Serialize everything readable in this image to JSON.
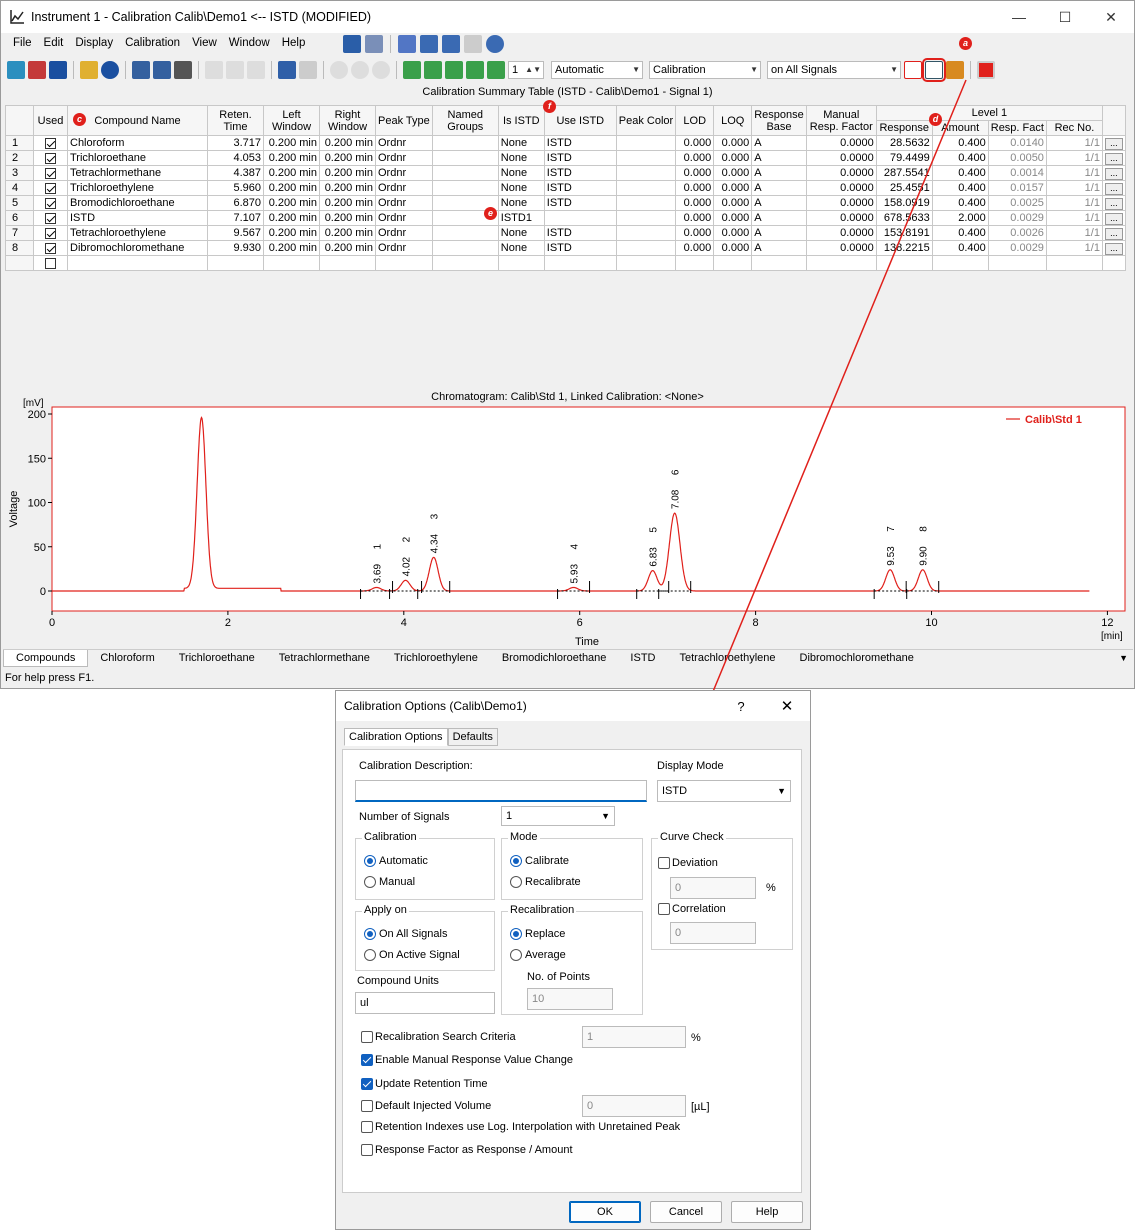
{
  "window": {
    "title": "Instrument 1 - Calibration Calib\\Demo1 <-- ISTD (MODIFIED)",
    "minimize": "—",
    "maximize": "☐",
    "close": "✕"
  },
  "menu": [
    "File",
    "Edit",
    "Display",
    "Calibration",
    "View",
    "Window",
    "Help"
  ],
  "toolbar": {
    "spin_value": "1",
    "combo_mode": "Automatic",
    "combo_calibration": "Calibration",
    "combo_signals": "on All Signals"
  },
  "callouts": {
    "a": "a",
    "c": "c",
    "d": "d",
    "e": "e",
    "f": "f"
  },
  "table": {
    "title": "Calibration Summary Table (ISTD - Calib\\Demo1 - Signal 1)",
    "headers": {
      "used": "Used",
      "compound": "Compound Name",
      "reten": "Reten. Time",
      "left": "Left Window",
      "right": "Right Window",
      "peaktype": "Peak Type",
      "named": "Named Groups",
      "isistd": "Is ISTD",
      "useistd": "Use ISTD",
      "peakcolor": "Peak Color",
      "lod": "LOD",
      "loq": "LOQ",
      "respbase": "Response Base",
      "manual": "Manual Resp. Factor",
      "level": "Level 1",
      "response": "Response",
      "amount": "Amount",
      "respfact": "Resp. Fact",
      "recno": "Rec No."
    },
    "rows": [
      {
        "n": "1",
        "used": true,
        "name": "Chloroform",
        "rt": "3.717",
        "lw": "0.200 min",
        "rw": "0.200 min",
        "pt": "Ordnr",
        "ng": "",
        "is": "None",
        "use": "ISTD",
        "lod": "0.000",
        "loq": "0.000",
        "rb": "A",
        "mrf": "0.0000",
        "resp": "28.5632",
        "amt": "0.400",
        "rf": "0.0140",
        "rec": "1/1"
      },
      {
        "n": "2",
        "used": true,
        "name": "Trichloroethane",
        "rt": "4.053",
        "lw": "0.200 min",
        "rw": "0.200 min",
        "pt": "Ordnr",
        "ng": "",
        "is": "None",
        "use": "ISTD",
        "lod": "0.000",
        "loq": "0.000",
        "rb": "A",
        "mrf": "0.0000",
        "resp": "79.4499",
        "amt": "0.400",
        "rf": "0.0050",
        "rec": "1/1"
      },
      {
        "n": "3",
        "used": true,
        "name": "Tetrachlormethane",
        "rt": "4.387",
        "lw": "0.200 min",
        "rw": "0.200 min",
        "pt": "Ordnr",
        "ng": "",
        "is": "None",
        "use": "ISTD",
        "lod": "0.000",
        "loq": "0.000",
        "rb": "A",
        "mrf": "0.0000",
        "resp": "287.5541",
        "amt": "0.400",
        "rf": "0.0014",
        "rec": "1/1"
      },
      {
        "n": "4",
        "used": true,
        "name": "Trichloroethylene",
        "rt": "5.960",
        "lw": "0.200 min",
        "rw": "0.200 min",
        "pt": "Ordnr",
        "ng": "",
        "is": "None",
        "use": "ISTD",
        "lod": "0.000",
        "loq": "0.000",
        "rb": "A",
        "mrf": "0.0000",
        "resp": "25.4551",
        "amt": "0.400",
        "rf": "0.0157",
        "rec": "1/1"
      },
      {
        "n": "5",
        "used": true,
        "name": "Bromodichloroethane",
        "rt": "6.870",
        "lw": "0.200 min",
        "rw": "0.200 min",
        "pt": "Ordnr",
        "ng": "",
        "is": "None",
        "use": "ISTD",
        "lod": "0.000",
        "loq": "0.000",
        "rb": "A",
        "mrf": "0.0000",
        "resp": "158.0919",
        "amt": "0.400",
        "rf": "0.0025",
        "rec": "1/1"
      },
      {
        "n": "6",
        "used": true,
        "name": "ISTD",
        "rt": "7.107",
        "lw": "0.200 min",
        "rw": "0.200 min",
        "pt": "Ordnr",
        "ng": "",
        "is": "ISTD1",
        "use": "",
        "lod": "0.000",
        "loq": "0.000",
        "rb": "A",
        "mrf": "0.0000",
        "resp": "678.5633",
        "amt": "2.000",
        "rf": "0.0029",
        "rec": "1/1"
      },
      {
        "n": "7",
        "used": true,
        "name": "Tetrachloroethylene",
        "rt": "9.567",
        "lw": "0.200 min",
        "rw": "0.200 min",
        "pt": "Ordnr",
        "ng": "",
        "is": "None",
        "use": "ISTD",
        "lod": "0.000",
        "loq": "0.000",
        "rb": "A",
        "mrf": "0.0000",
        "resp": "153.8191",
        "amt": "0.400",
        "rf": "0.0026",
        "rec": "1/1"
      },
      {
        "n": "8",
        "used": true,
        "name": "Dibromochloromethane",
        "rt": "9.930",
        "lw": "0.200 min",
        "rw": "0.200 min",
        "pt": "Ordnr",
        "ng": "",
        "is": "None",
        "use": "ISTD",
        "lod": "0.000",
        "loq": "0.000",
        "rb": "A",
        "mrf": "0.0000",
        "resp": "138.2215",
        "amt": "0.400",
        "rf": "0.0029",
        "rec": "1/1"
      }
    ],
    "more_button": "..."
  },
  "chart_data": {
    "type": "line",
    "title": "Chromatogram: Calib\\Std 1, Linked Calibration: <None>",
    "xlabel": "Time",
    "ylabel": "Voltage",
    "xunit": "[min]",
    "yunit": "[mV]",
    "xlim": [
      0,
      12
    ],
    "ylim": [
      -5,
      210
    ],
    "xticks": [
      0,
      2,
      4,
      6,
      8,
      10,
      12
    ],
    "yticks": [
      0,
      50,
      100,
      150,
      200
    ],
    "legend": "Calib\\Std 1",
    "legend_position": "top-right",
    "color": "#e0201b",
    "peaks": [
      {
        "rt": 1.7,
        "height": 193,
        "width": 0.05,
        "label": "",
        "num": ""
      },
      {
        "rt": 3.69,
        "height": 4,
        "width": 0.05,
        "label": "3.69",
        "num": "1"
      },
      {
        "rt": 4.02,
        "height": 12,
        "width": 0.05,
        "label": "4.02",
        "num": "2"
      },
      {
        "rt": 4.34,
        "height": 38,
        "width": 0.05,
        "label": "4.34",
        "num": "3"
      },
      {
        "rt": 5.93,
        "height": 4,
        "width": 0.05,
        "label": "5.93",
        "num": "4"
      },
      {
        "rt": 6.83,
        "height": 23,
        "width": 0.05,
        "label": "6.83",
        "num": "5"
      },
      {
        "rt": 7.08,
        "height": 88,
        "width": 0.06,
        "label": "7.08",
        "num": "6"
      },
      {
        "rt": 9.53,
        "height": 24,
        "width": 0.05,
        "label": "9.53",
        "num": "7"
      },
      {
        "rt": 9.9,
        "height": 24,
        "width": 0.05,
        "label": "9.90",
        "num": "8"
      }
    ]
  },
  "bottom_tabs": [
    "Compounds",
    "Chloroform",
    "Trichloroethane",
    "Tetrachlormethane",
    "Trichloroethylene",
    "Bromodichloroethane",
    "ISTD",
    "Tetrachloroethylene",
    "Dibromochloromethane"
  ],
  "status": "For help press F1.",
  "dialog": {
    "title": "Calibration Options (Calib\\Demo1)",
    "help": "?",
    "close": "✕",
    "tabs": [
      "Calibration Options",
      "Defaults"
    ],
    "calib_desc_label": "Calibration Description:",
    "calib_desc_value": "",
    "display_mode_label": "Display Mode",
    "display_mode_value": "ISTD",
    "num_signals_label": "Number of Signals",
    "num_signals_value": "1",
    "calibration_group": "Calibration",
    "automatic": "Automatic",
    "manual": "Manual",
    "mode_group": "Mode",
    "calibrate": "Calibrate",
    "recalibrate": "Recalibrate",
    "curve_group": "Curve Check",
    "deviation": "Deviation",
    "deviation_value": "0",
    "pct": "%",
    "correlation": "Correlation",
    "correlation_value": "0",
    "apply_group": "Apply on",
    "all_signals": "On All Signals",
    "active_signal": "On Active Signal",
    "recal_group": "Recalibration",
    "replace": "Replace",
    "average": "Average",
    "points_label": "No. of Points",
    "points_value": "10",
    "units_label": "Compound Units",
    "units_value": "ul",
    "recal_search": "Recalibration Search Criteria",
    "recal_search_value": "1",
    "manual_resp": "Enable Manual Response Value Change",
    "update_rt": "Update Retention Time",
    "default_inj": "Default Injected Volume",
    "default_inj_value": "0",
    "ul_unit": "[µL]",
    "retention_idx": "Retention Indexes use Log. Interpolation with Unretained Peak",
    "resp_factor": "Response Factor as Response / Amount",
    "ok": "OK",
    "cancel": "Cancel",
    "help_btn": "Help"
  }
}
